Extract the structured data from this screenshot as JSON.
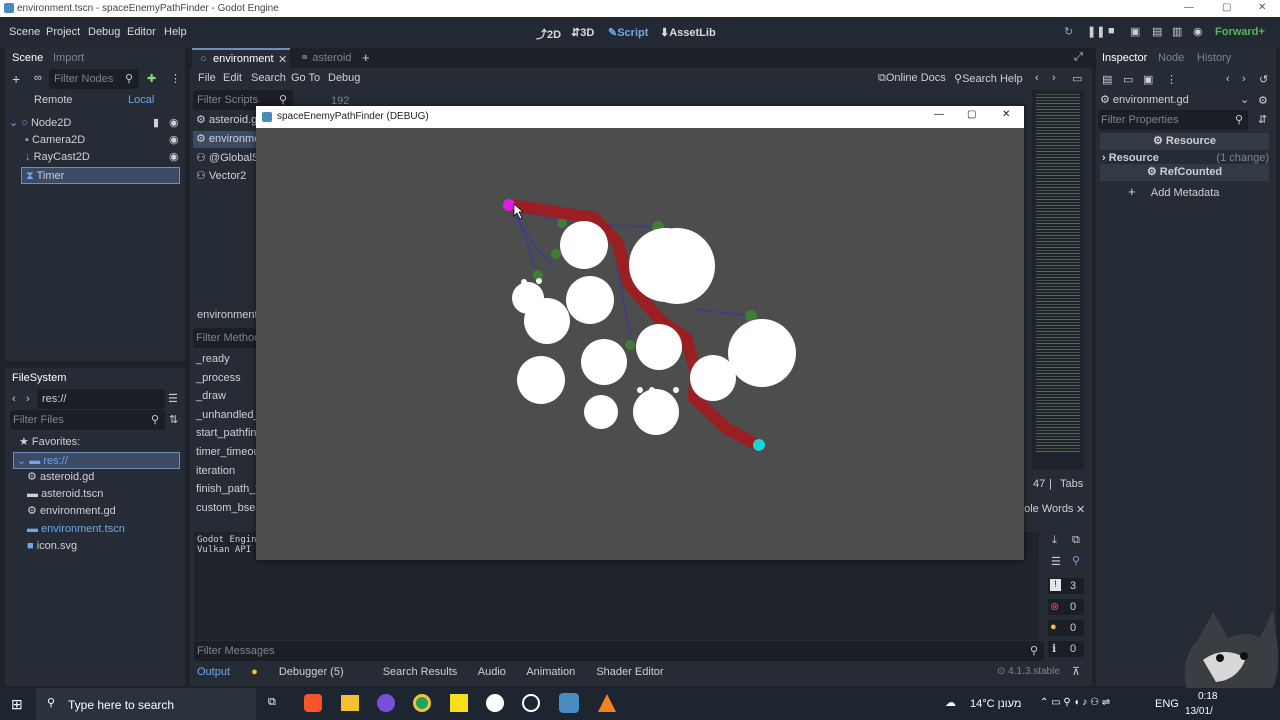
{
  "window": {
    "title": "environment.tscn - spaceEnemyPathFinder - Godot Engine"
  },
  "menu": [
    "Scene",
    "Project",
    "Debug",
    "Editor",
    "Help"
  ],
  "workspaces": [
    "2D",
    "3D",
    "Script",
    "AssetLib"
  ],
  "renderer": "Forward+",
  "scene_dock": {
    "tabs": [
      "Scene",
      "Import"
    ],
    "filter_placeholder": "Filter Nodes",
    "remote": "Remote",
    "local": "Local",
    "nodes": [
      "Node2D",
      "Camera2D",
      "RayCast2D",
      "Timer"
    ]
  },
  "filesystem": {
    "tab": "FileSystem",
    "path": "res://",
    "filter_placeholder": "Filter Files",
    "favorites": "Favorites:",
    "items": [
      "res://",
      "asteroid.gd",
      "asteroid.tscn",
      "environment.gd",
      "environment.tscn",
      "icon.svg"
    ]
  },
  "editor_tabs": [
    "environment",
    "asteroid"
  ],
  "script_menu": [
    "File",
    "Edit",
    "Search",
    "Go To",
    "Debug"
  ],
  "script_tools": {
    "online_docs": "Online Docs",
    "search_help": "Search Help"
  },
  "script_list": {
    "filter_placeholder": "Filter Scripts",
    "items": [
      "asteroid.g",
      "environme",
      "@GlobalSc",
      "Vector2"
    ],
    "current": "environment.",
    "filter_methods": "Filter Method",
    "methods": [
      "_ready",
      "_process",
      "_draw",
      "_unhandled_i",
      "start_pathfin",
      "timer_timeou",
      "iteration",
      "finish_path_fi",
      "custom_bsear"
    ]
  },
  "line_number": "192",
  "status": {
    "line": "47",
    "tabs": "Tabs",
    "whole_words": "hole Words"
  },
  "output": {
    "lines": [
      "Godot Engin",
      "Vulkan API "
    ],
    "filter_placeholder": "Filter Messages",
    "counts": [
      "3",
      "0",
      "0",
      "0"
    ]
  },
  "bottom_tabs": [
    "Output",
    "Debugger (5)",
    "Search Results",
    "Audio",
    "Animation",
    "Shader Editor"
  ],
  "version": "4.1.3.stable",
  "inspector": {
    "tabs": [
      "Inspector",
      "Node",
      "History"
    ],
    "file": "environment.gd",
    "filter_placeholder": "Filter Properties",
    "resource_header": "Resource",
    "resource_row": "Resource",
    "change": "(1 change)",
    "refcounted": "RefCounted",
    "add_metadata": "Add Metadata"
  },
  "game_window": {
    "title": "spaceEnemyPathFinder (DEBUG)"
  },
  "taskbar": {
    "search_placeholder": "Type here to search",
    "weather": "14°C מעונן",
    "lang": "ENG",
    "time": "0:18",
    "date": "13/01/"
  },
  "colors": {
    "accent": "#6f8fb9",
    "path": "#a8161b",
    "start": "#e11be6",
    "goal": "#16d6dd"
  }
}
